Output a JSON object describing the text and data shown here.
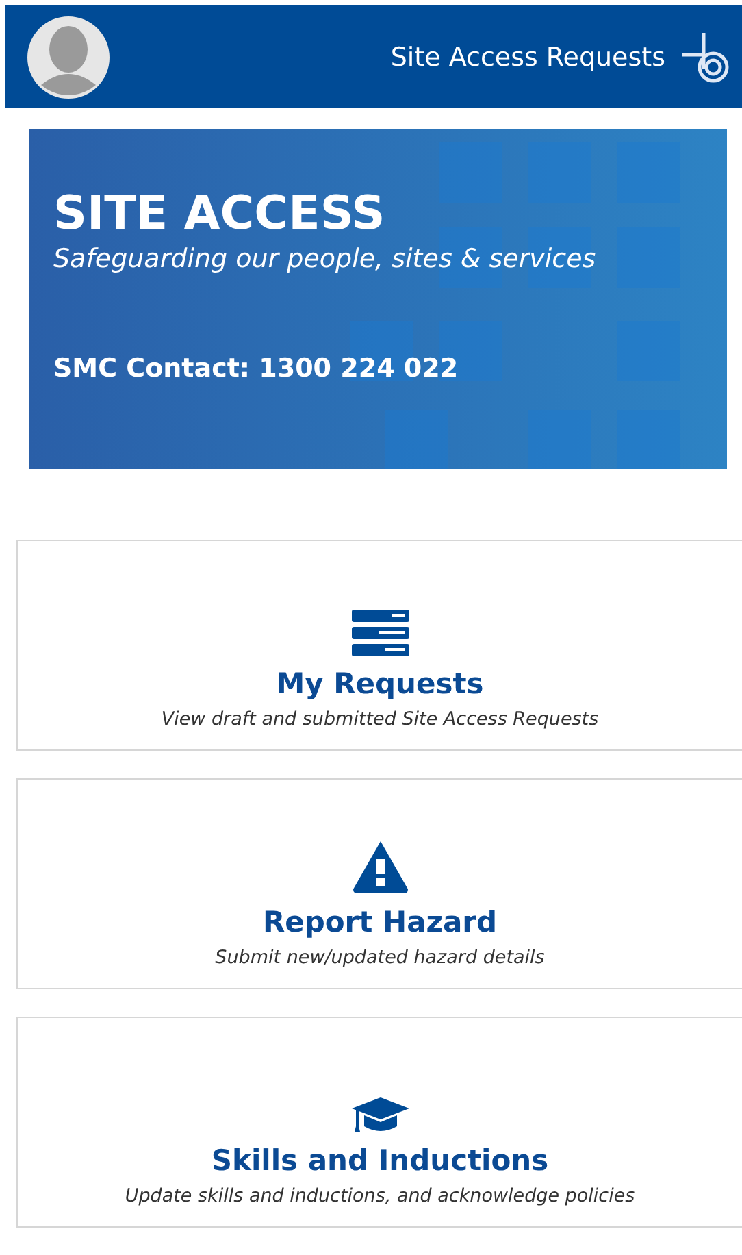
{
  "header": {
    "title": "Site Access Requests"
  },
  "banner": {
    "title": "SITE ACCESS",
    "subtitle": "Safeguarding our people, sites & services",
    "contact": "SMC Contact: 1300 224 022"
  },
  "cards": [
    {
      "kind": "list",
      "title": "My Requests",
      "description": "View draft and submitted Site Access Requests"
    },
    {
      "kind": "warning",
      "title": "Report Hazard",
      "description": "Submit new/updated hazard details"
    },
    {
      "kind": "education",
      "title": "Skills and Inductions",
      "description": "Update skills and inductions, and acknowledge policies"
    }
  ]
}
